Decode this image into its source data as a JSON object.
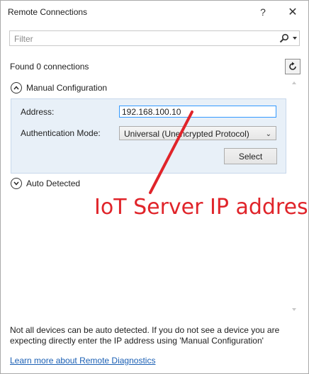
{
  "window": {
    "title": "Remote Connections",
    "help_glyph": "?",
    "close_glyph": "✕"
  },
  "filter": {
    "placeholder": "Filter",
    "value": ""
  },
  "status": {
    "found_text": "Found 0 connections"
  },
  "manual": {
    "header": "Manual Configuration",
    "address_label": "Address:",
    "address_value": "192.168.100.10",
    "auth_label": "Authentication Mode:",
    "auth_value": "Universal (Unencrypted Protocol)",
    "select_label": "Select"
  },
  "auto": {
    "header": "Auto Detected"
  },
  "annotation": {
    "text": "IoT Server IP address",
    "color": "#e0242a"
  },
  "footer": {
    "note": "Not all devices can be auto detected. If you do not see a device you are expecting directly enter the IP address using 'Manual Configuration'",
    "link_text": "Learn more about Remote Diagnostics"
  },
  "icons": {
    "search": "search-icon",
    "refresh": "refresh-icon",
    "collapse": "chevron-up-icon",
    "expand": "chevron-down-icon"
  }
}
